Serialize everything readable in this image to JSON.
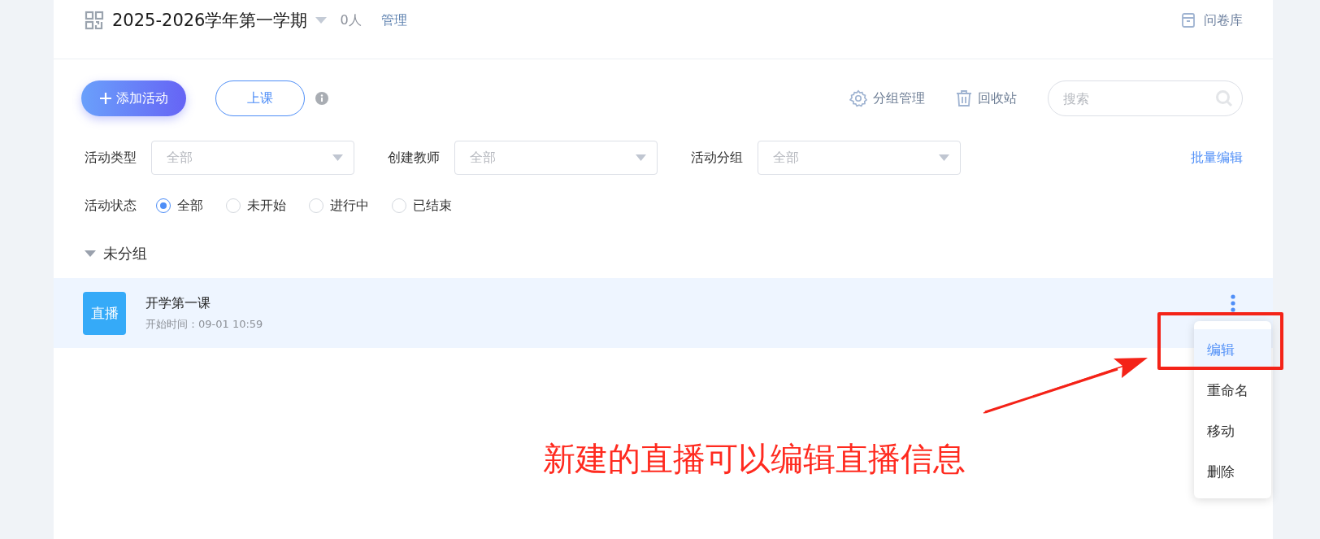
{
  "header": {
    "title": "2025-2026学年第一学期",
    "members": "0人",
    "manage_link": "管理",
    "library_link": "问卷库"
  },
  "toolbar": {
    "add_button": "添加活动",
    "class_button": "上课",
    "group_manage": "分组管理",
    "recycle_bin": "回收站",
    "search": {
      "placeholder": "搜索"
    }
  },
  "filters": [
    {
      "label": "活动类型",
      "placeholder": "全部"
    },
    {
      "label": "创建教师",
      "placeholder": "全部"
    },
    {
      "label": "活动分组",
      "placeholder": "全部"
    }
  ],
  "batch_edit": "批量编辑",
  "status_filter": {
    "label": "活动状态",
    "options": [
      {
        "label": "全部",
        "selected": true
      },
      {
        "label": "未开始",
        "selected": false
      },
      {
        "label": "进行中",
        "selected": false
      },
      {
        "label": "已结束",
        "selected": false
      }
    ]
  },
  "groups": [
    {
      "name": "未分组",
      "expanded": true,
      "activities": [
        {
          "badge": "直播",
          "title": "开学第一课",
          "start_time": "开始时间：09-01 10:59",
          "highlighted": true
        }
      ]
    }
  ],
  "context_menu": {
    "items": [
      {
        "label": "编辑",
        "selected": true
      },
      {
        "label": "重命名",
        "selected": false
      },
      {
        "label": "移动",
        "selected": false
      },
      {
        "label": "删除",
        "selected": false
      }
    ]
  },
  "annotation": {
    "text": "新建的直播可以编辑直播信息"
  }
}
